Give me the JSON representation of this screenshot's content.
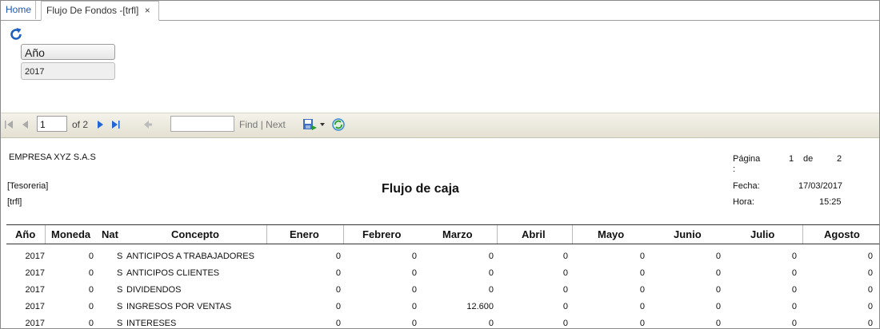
{
  "tabs": {
    "home": "Home",
    "active": "Flujo De Fondos -[trfl]",
    "close": "×"
  },
  "params": {
    "label": "Año",
    "value": "2017"
  },
  "toolbar": {
    "page_value": "1",
    "of_text": "of 2",
    "find": "Find",
    "sep": "|",
    "next": "Next"
  },
  "report": {
    "company": "EMPRESA XYZ S.A.S",
    "tesoreria": "[Tesoreria]",
    "code": "[trfl]",
    "title": "Flujo de caja",
    "pagina_label": "Página",
    "pagina_colon": ":",
    "pagina_num": "1",
    "de_label": "de",
    "pagina_total": "2",
    "fecha_label": "Fecha:",
    "fecha_value": "17/03/2017",
    "hora_label": "Hora:",
    "hora_value": "15:25"
  },
  "table": {
    "headers": [
      "Año",
      "Moneda",
      "Nat",
      "Concepto",
      "Enero",
      "Febrero",
      "Marzo",
      "Abril",
      "Mayo",
      "Junio",
      "Julio",
      "Agosto"
    ],
    "rows": [
      {
        "anio": "2017",
        "moneda": "0",
        "nat": "S",
        "concepto": "ANTICIPOS A TRABAJADORES",
        "enero": "0",
        "febrero": "0",
        "marzo": "0",
        "abril": "0",
        "mayo": "0",
        "junio": "0",
        "julio": "0",
        "agosto": "0"
      },
      {
        "anio": "2017",
        "moneda": "0",
        "nat": "S",
        "concepto": "ANTICIPOS CLIENTES",
        "enero": "0",
        "febrero": "0",
        "marzo": "0",
        "abril": "0",
        "mayo": "0",
        "junio": "0",
        "julio": "0",
        "agosto": "0"
      },
      {
        "anio": "2017",
        "moneda": "0",
        "nat": "S",
        "concepto": "DIVIDENDOS",
        "enero": "0",
        "febrero": "0",
        "marzo": "0",
        "abril": "0",
        "mayo": "0",
        "junio": "0",
        "julio": "0",
        "agosto": "0"
      },
      {
        "anio": "2017",
        "moneda": "0",
        "nat": "S",
        "concepto": "INGRESOS POR VENTAS",
        "enero": "0",
        "febrero": "0",
        "marzo": "12.600",
        "abril": "0",
        "mayo": "0",
        "junio": "0",
        "julio": "0",
        "agosto": "0"
      },
      {
        "anio": "2017",
        "moneda": "0",
        "nat": "S",
        "concepto": "INTERESES",
        "enero": "0",
        "febrero": "0",
        "marzo": "0",
        "abril": "0",
        "mayo": "0",
        "junio": "0",
        "julio": "0",
        "agosto": "0"
      }
    ]
  },
  "colors": {
    "link": "#1a56b0",
    "toolbar_bg": "#ece9dc"
  }
}
